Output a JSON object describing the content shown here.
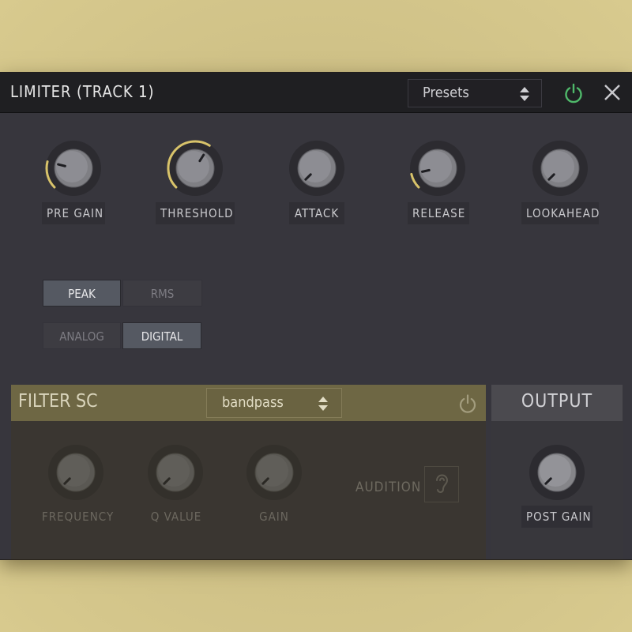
{
  "window": {
    "title": "LIMITER (TRACK 1)",
    "presets_label": "Presets"
  },
  "knobs": [
    {
      "label": "PRE GAIN",
      "value": 0.22
    },
    {
      "label": "THRESHOLD",
      "value": 0.62
    },
    {
      "label": "ATTACK",
      "value": 0.0
    },
    {
      "label": "RELEASE",
      "value": 0.12
    },
    {
      "label": "LOOKAHEAD",
      "value": 0.0
    }
  ],
  "detection": {
    "options": [
      "PEAK",
      "RMS"
    ],
    "selected": "PEAK"
  },
  "character": {
    "options": [
      "ANALOG",
      "DIGITAL"
    ],
    "selected": "DIGITAL"
  },
  "filter_sc": {
    "title": "FILTER SC",
    "mode": "bandpass",
    "knobs": [
      {
        "label": "FREQUENCY"
      },
      {
        "label": "Q VALUE"
      },
      {
        "label": "GAIN"
      }
    ],
    "audition_label": "AUDITION"
  },
  "output": {
    "title": "OUTPUT",
    "knob_label": "POST GAIN"
  },
  "colors": {
    "accent": "#d8c36a",
    "power_on": "#4fb86a",
    "background_outer": "#cfc187"
  }
}
